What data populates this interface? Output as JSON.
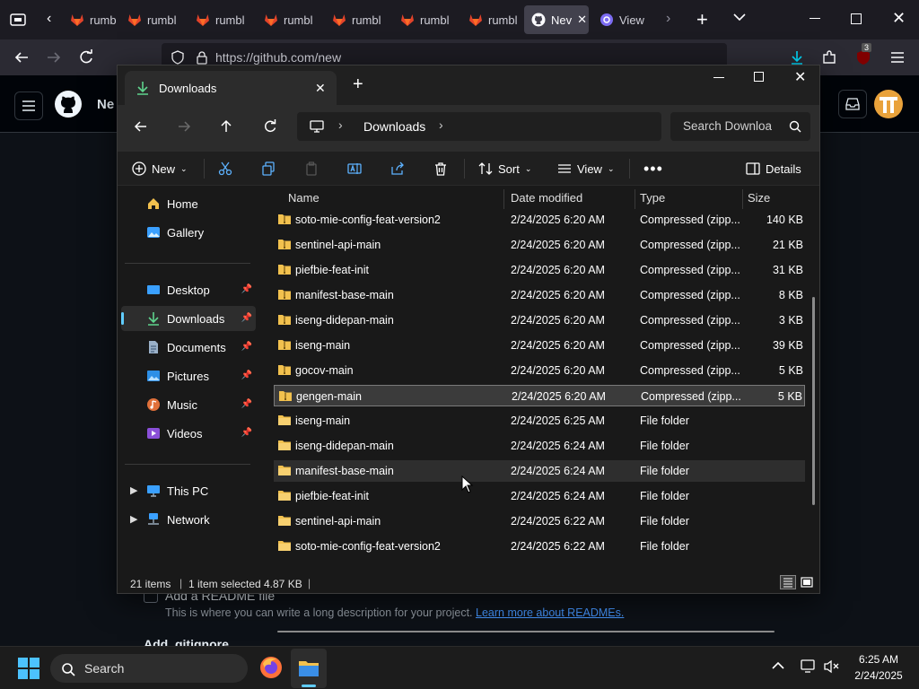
{
  "firefox": {
    "tabs": [
      {
        "label": "rumbl"
      },
      {
        "label": "rumbl"
      },
      {
        "label": "rumbl"
      },
      {
        "label": "rumbl"
      },
      {
        "label": "rumbl"
      },
      {
        "label": "rumbl"
      },
      {
        "label": "rumbl"
      },
      {
        "label": "Nev"
      },
      {
        "label": "View"
      }
    ],
    "url": "https://github.com/new",
    "badge_count": "3"
  },
  "github": {
    "header_title": "Ne",
    "readme_label": "Add a README file",
    "readme_desc": "This is where you can write a long description for your project.",
    "readme_link": "Learn more about READMEs.",
    "gitignore_label": "Add .gitignore"
  },
  "explorer": {
    "tab_title": "Downloads",
    "breadcrumb": "Downloads",
    "search_placeholder": "Search Downloa",
    "toolbar": {
      "new_label": "New",
      "sort_label": "Sort",
      "view_label": "View",
      "details_label": "Details"
    },
    "nav": {
      "home": "Home",
      "gallery": "Gallery",
      "desktop": "Desktop",
      "downloads": "Downloads",
      "documents": "Documents",
      "pictures": "Pictures",
      "music": "Music",
      "videos": "Videos",
      "this_pc": "This PC",
      "network": "Network"
    },
    "columns": {
      "name": "Name",
      "date": "Date modified",
      "type": "Type",
      "size": "Size"
    },
    "files": [
      {
        "name": "soto-mie-config-feat-version2",
        "date": "2/24/2025 6:20 AM",
        "type": "Compressed (zipp...",
        "size": "140 KB",
        "kind": "zip"
      },
      {
        "name": "sentinel-api-main",
        "date": "2/24/2025 6:20 AM",
        "type": "Compressed (zipp...",
        "size": "21 KB",
        "kind": "zip"
      },
      {
        "name": "piefbie-feat-init",
        "date": "2/24/2025 6:20 AM",
        "type": "Compressed (zipp...",
        "size": "31 KB",
        "kind": "zip"
      },
      {
        "name": "manifest-base-main",
        "date": "2/24/2025 6:20 AM",
        "type": "Compressed (zipp...",
        "size": "8 KB",
        "kind": "zip"
      },
      {
        "name": "iseng-didepan-main",
        "date": "2/24/2025 6:20 AM",
        "type": "Compressed (zipp...",
        "size": "3 KB",
        "kind": "zip"
      },
      {
        "name": "iseng-main",
        "date": "2/24/2025 6:20 AM",
        "type": "Compressed (zipp...",
        "size": "39 KB",
        "kind": "zip"
      },
      {
        "name": "gocov-main",
        "date": "2/24/2025 6:20 AM",
        "type": "Compressed (zipp...",
        "size": "5 KB",
        "kind": "zip"
      },
      {
        "name": "gengen-main",
        "date": "2/24/2025 6:20 AM",
        "type": "Compressed (zipp...",
        "size": "5 KB",
        "kind": "zip"
      },
      {
        "name": "iseng-main",
        "date": "2/24/2025 6:25 AM",
        "type": "File folder",
        "size": "",
        "kind": "folder"
      },
      {
        "name": "iseng-didepan-main",
        "date": "2/24/2025 6:24 AM",
        "type": "File folder",
        "size": "",
        "kind": "folder"
      },
      {
        "name": "manifest-base-main",
        "date": "2/24/2025 6:24 AM",
        "type": "File folder",
        "size": "",
        "kind": "folder"
      },
      {
        "name": "piefbie-feat-init",
        "date": "2/24/2025 6:24 AM",
        "type": "File folder",
        "size": "",
        "kind": "folder"
      },
      {
        "name": "sentinel-api-main",
        "date": "2/24/2025 6:22 AM",
        "type": "File folder",
        "size": "",
        "kind": "folder"
      },
      {
        "name": "soto-mie-config-feat-version2",
        "date": "2/24/2025 6:22 AM",
        "type": "File folder",
        "size": "",
        "kind": "folder"
      }
    ],
    "status": {
      "items": "21 items",
      "selected": "1 item selected",
      "size": "4.87 KB"
    }
  },
  "taskbar": {
    "search_label": "Search",
    "time": "6:25 AM",
    "date": "2/24/2025"
  },
  "colors": {
    "accent": "#60cdff",
    "folder": "#f2c14e",
    "firefox_orange": "#ff7139",
    "gitlab_orange": "#e2432a"
  }
}
